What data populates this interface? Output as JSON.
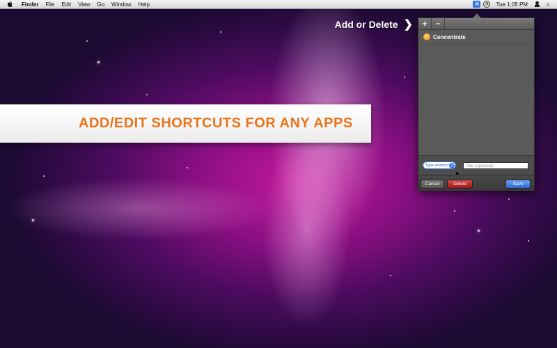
{
  "menubar": {
    "apple": "",
    "items": [
      "Finder",
      "File",
      "Edit",
      "View",
      "Go",
      "Window",
      "Help"
    ],
    "clock": "Tue 1:05 PM",
    "icons": [
      "apple-icon",
      "shortcut-extra-icon",
      "circle-icon",
      "user-icon",
      "spotlight-icon"
    ]
  },
  "callout": {
    "text": "Add or Delete",
    "chevron": "❯"
  },
  "banner": {
    "text": "ADD/EDIT SHORTCUTS FOR ANY APPS",
    "color": "#e9741c"
  },
  "panel": {
    "toolbar": {
      "add": "+",
      "remove": "−"
    },
    "list": [
      {
        "label": "Concentrate",
        "icon": "concentrate-app-icon"
      }
    ],
    "editor": {
      "shortcut_placeholder": "Type shortcut",
      "title_placeholder": "Title (optional)"
    },
    "footer": {
      "cancel": "Cancel",
      "delete": "Delete",
      "save": "Save"
    },
    "colors": {
      "delete": "#a01818",
      "save": "#2d69d6"
    }
  }
}
